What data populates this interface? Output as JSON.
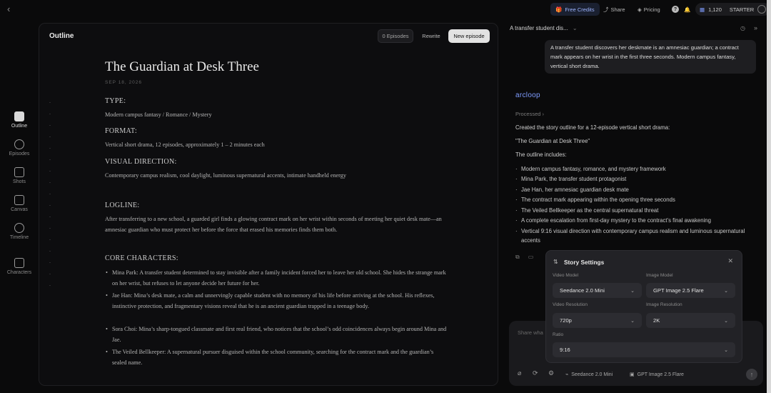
{
  "topbar": {
    "back": "‹",
    "free_credits": "Free Credits",
    "share": "Share",
    "pricing": "Pricing",
    "help": "?",
    "credits_value": "1,120",
    "plan": "STARTER"
  },
  "nav": {
    "items": [
      {
        "label": "Outline"
      },
      {
        "label": "Episodes"
      },
      {
        "label": "Shots"
      },
      {
        "label": "Canvas"
      },
      {
        "label": "Timeline"
      },
      {
        "label": "Characters"
      }
    ]
  },
  "doc": {
    "panel_title": "Outline",
    "episodes_btn": "0 Episodes",
    "rewrite_btn": "Rewrite",
    "new_episode_btn": "New episode",
    "title": "The Guardian at Desk Three",
    "date": "SEP 18, 2026",
    "type_h": "TYPE:",
    "type": "Modern campus fantasy / Romance / Mystery",
    "format_h": "FORMAT:",
    "format": "Vertical short drama, 12 episodes, approximately 1 – 2 minutes each",
    "visual_h": "VISUAL DIRECTION:",
    "visual": "Contemporary campus realism, cool daylight, luminous supernatural accents, intimate handheld energy",
    "logline_h": "LOGLINE:",
    "logline": "After transferring to a new school, a guarded girl finds a glowing contract mark on her wrist within seconds of meeting her quiet desk mate—an amnesiac guardian who must protect her before the force that erased his memories finds them both.",
    "chars_h": "CORE CHARACTERS:",
    "chars": [
      "Mina Park: A transfer student determined to stay invisible after a family incident forced her to leave her old school. She hides the strange mark on her wrist, but refuses to let anyone decide her future for her.",
      "Jae Han: Mina’s desk mate, a calm and unnervingly capable student with no memory of his life before arriving at the school. His reflexes, instinctive protection, and fragmentary visions reveal that he is an ancient guardian trapped in a teenage body.",
      "Sora Choi: Mina’s sharp-tongued classmate and first real friend, who notices that the school’s odd coincidences always begin around Mina and Jae.",
      "The Veiled Bellkeeper: A supernatural pursuer disguised within the school community, searching for the contract mark and the guardian’s sealed name."
    ]
  },
  "chat": {
    "thread_title": "A transfer student dis...",
    "user_msg": "A transfer student discovers her deskmate is an amnesiac guardian; a contract mark appears on her wrist in the first three seconds. Modern campus fantasy, vertical short drama.",
    "logo": "arcloop",
    "processed": "Processed ›",
    "resp1": "Created the story outline for a 12-episode vertical short drama:",
    "resp2": "\"The Guardian at Desk Three\"",
    "resp3": "The outline includes:",
    "items": [
      "Modern campus fantasy, romance, and mystery framework",
      "Mina Park, the transfer student protagonist",
      "Jae Han, her amnesiac guardian desk mate",
      "The contract mark appearing within the opening three seconds",
      "The Veiled Bellkeeper as the central supernatural threat",
      "A complete escalation from first-day mystery to the contract’s final awakening",
      "Vertical 9:16 visual direction with contemporary campus realism and luminous supernatural accents"
    ],
    "placeholder": "Share wha",
    "chip_video": "Seedance 2.0 Mini",
    "chip_image": "GPT Image 2.5 Flare"
  },
  "modal": {
    "title": "Story Settings",
    "video_model_label": "Video Model",
    "video_model": "Seedance 2.0 Mini",
    "image_model_label": "Image Model",
    "image_model": "GPT Image 2.5 Flare",
    "video_res_label": "Video Resolution",
    "video_res": "720p",
    "image_res_label": "Image Resolution",
    "image_res": "2K",
    "ratio_label": "Ratio",
    "ratio": "9:16"
  }
}
